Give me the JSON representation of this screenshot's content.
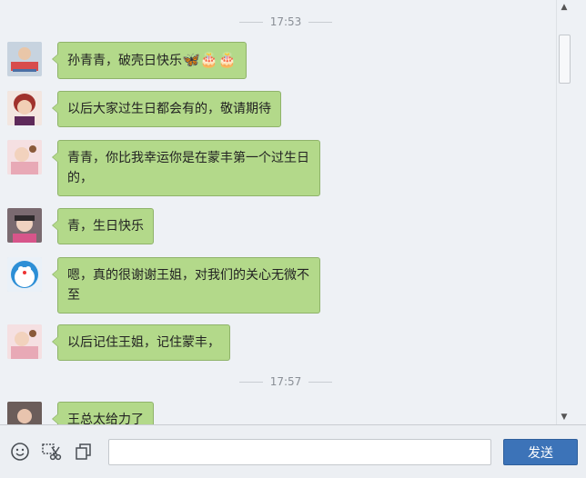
{
  "timestamps": {
    "t1": "17:53",
    "t2": "17:57"
  },
  "messages": [
    {
      "text": "孙青青，破壳日快乐",
      "emoji": "🦋🎂🎂",
      "avatar": "avatar-1"
    },
    {
      "text": "以后大家过生日都会有的，敬请期待",
      "avatar": "avatar-2"
    },
    {
      "line1": "青青，你比我幸运你是在蒙丰第一个过生日",
      "line2": "的，",
      "avatar": "avatar-3"
    },
    {
      "text": "青，生日快乐",
      "avatar": "avatar-4"
    },
    {
      "line1": "嗯，真的很谢谢王姐，对我们的关心无微不",
      "line2": "至",
      "avatar": "doraemon-avatar"
    },
    {
      "text": "以后记住王姐，记住蒙丰，",
      "avatar": "avatar-3"
    },
    {
      "text": "王总太给力了",
      "avatar": "avatar-6"
    }
  ],
  "toolbar": {
    "emoji_icon": "smiley-icon",
    "screenshot_icon": "scissors-icon",
    "window_icon": "copy-window-icon",
    "input_value": "",
    "send_label": "发送"
  },
  "colors": {
    "bubble": "#b3d98a",
    "send": "#3c73b8",
    "background": "#eef1f5"
  }
}
